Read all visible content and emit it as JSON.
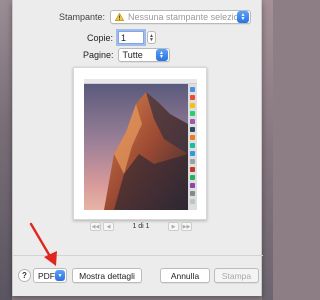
{
  "printer": {
    "label": "Stampante:",
    "value": "Nessuna stampante selezionata"
  },
  "copies": {
    "label": "Copie:",
    "value": "1"
  },
  "pages": {
    "label": "Pagine:",
    "value": "Tutte"
  },
  "preview": {
    "page_indicator": "1 di 1",
    "first_icon": "double-chevron-left",
    "prev_icon": "chevron-left",
    "next_icon": "chevron-right",
    "last_icon": "double-chevron-right"
  },
  "buttons": {
    "help": "?",
    "pdf": "PDF",
    "details": "Mostra dettagli",
    "cancel": "Annulla",
    "print": "Stampa"
  },
  "colors": {
    "accent": "#2b72e0",
    "annotation_arrow": "#e0261d"
  }
}
